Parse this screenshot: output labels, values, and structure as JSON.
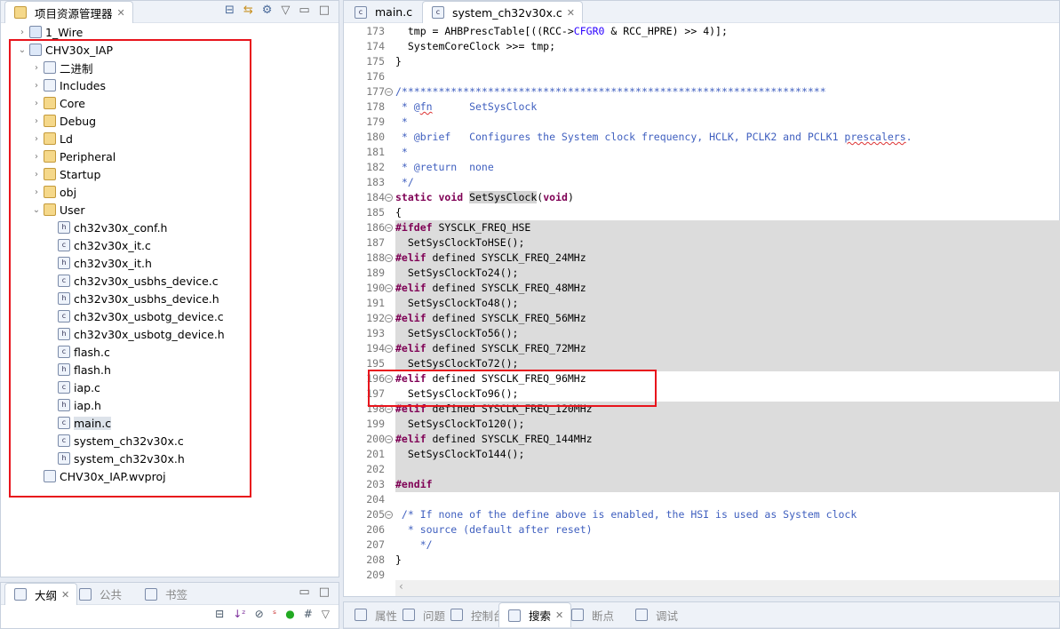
{
  "explorer": {
    "title": "项目资源管理器",
    "tree": [
      {
        "label": "1_Wire",
        "level": 0,
        "expander": "closed",
        "icon": "project-icon"
      },
      {
        "label": "CHV30x_IAP",
        "level": 0,
        "expander": "open",
        "icon": "project-icon"
      },
      {
        "label": "二进制",
        "level": 1,
        "expander": "closed",
        "icon": "binaries-icon"
      },
      {
        "label": "Includes",
        "level": 1,
        "expander": "closed",
        "icon": "includes-icon"
      },
      {
        "label": "Core",
        "level": 1,
        "expander": "closed",
        "icon": "source-folder-icon"
      },
      {
        "label": "Debug",
        "level": 1,
        "expander": "closed",
        "icon": "source-folder-icon"
      },
      {
        "label": "Ld",
        "level": 1,
        "expander": "closed",
        "icon": "source-folder-icon"
      },
      {
        "label": "Peripheral",
        "level": 1,
        "expander": "closed",
        "icon": "source-folder-icon"
      },
      {
        "label": "Startup",
        "level": 1,
        "expander": "closed",
        "icon": "source-folder-icon"
      },
      {
        "label": "obj",
        "level": 1,
        "expander": "closed",
        "icon": "folder-icon"
      },
      {
        "label": "User",
        "level": 1,
        "expander": "open",
        "icon": "folder-icon"
      },
      {
        "label": "ch32v30x_conf.h",
        "level": 2,
        "icon": "h-file-icon"
      },
      {
        "label": "ch32v30x_it.c",
        "level": 2,
        "icon": "c-file-icon"
      },
      {
        "label": "ch32v30x_it.h",
        "level": 2,
        "icon": "h-file-icon"
      },
      {
        "label": "ch32v30x_usbhs_device.c",
        "level": 2,
        "icon": "c-file-icon"
      },
      {
        "label": "ch32v30x_usbhs_device.h",
        "level": 2,
        "icon": "h-file-icon"
      },
      {
        "label": "ch32v30x_usbotg_device.c",
        "level": 2,
        "icon": "c-file-icon"
      },
      {
        "label": "ch32v30x_usbotg_device.h",
        "level": 2,
        "icon": "h-file-icon"
      },
      {
        "label": "flash.c",
        "level": 2,
        "icon": "c-file-icon"
      },
      {
        "label": "flash.h",
        "level": 2,
        "icon": "h-file-icon"
      },
      {
        "label": "iap.c",
        "level": 2,
        "icon": "c-file-icon"
      },
      {
        "label": "iap.h",
        "level": 2,
        "icon": "h-file-icon"
      },
      {
        "label": "main.c",
        "level": 2,
        "icon": "c-file-icon",
        "selected": true
      },
      {
        "label": "system_ch32v30x.c",
        "level": 2,
        "icon": "c-file-icon"
      },
      {
        "label": "system_ch32v30x.h",
        "level": 2,
        "icon": "h-file-icon"
      },
      {
        "label": "CHV30x_IAP.wvproj",
        "level": 1,
        "icon": "wvproj-file-icon"
      }
    ]
  },
  "editor": {
    "tabs": [
      {
        "label": "main.c"
      },
      {
        "label": "system_ch32v30x.c",
        "active": true
      }
    ],
    "lines": [
      {
        "n": "173",
        "s": [
          [
            "",
            "  tmp = AHBPrescTable[((RCC->"
          ],
          [
            "f",
            "CFGR0"
          ],
          [
            "",
            " & RCC_HPRE) >> 4)];"
          ]
        ]
      },
      {
        "n": "174",
        "s": [
          [
            "",
            "  SystemCoreClock >>= tmp;"
          ]
        ]
      },
      {
        "n": "175",
        "s": [
          [
            "",
            "}"
          ]
        ]
      },
      {
        "n": "176",
        "s": []
      },
      {
        "n": "177",
        "fold": true,
        "s": [
          [
            "c",
            "/*********************************************************************"
          ]
        ]
      },
      {
        "n": "178",
        "s": [
          [
            "c",
            " * @"
          ],
          [
            "c sq",
            "fn"
          ],
          [
            "c",
            "      SetSysClock"
          ]
        ]
      },
      {
        "n": "179",
        "s": [
          [
            "c",
            " *"
          ]
        ]
      },
      {
        "n": "180",
        "s": [
          [
            "c",
            " * @brief   Configures the System clock frequency, HCLK, PCLK2 and PCLK1 "
          ],
          [
            "c sq",
            "prescalers"
          ],
          [
            "c",
            "."
          ]
        ]
      },
      {
        "n": "181",
        "s": [
          [
            "c",
            " *"
          ]
        ]
      },
      {
        "n": "182",
        "s": [
          [
            "c",
            " * @return  none"
          ]
        ]
      },
      {
        "n": "183",
        "s": [
          [
            "c",
            " */"
          ]
        ]
      },
      {
        "n": "184",
        "fold": true,
        "s": [
          [
            "k",
            "static"
          ],
          [
            "",
            " "
          ],
          [
            "k",
            "void"
          ],
          [
            "",
            " "
          ],
          [
            "hl",
            "SetSysClock"
          ],
          [
            "",
            "("
          ],
          [
            "k",
            "void"
          ],
          [
            "",
            ")"
          ]
        ]
      },
      {
        "n": "185",
        "s": [
          [
            "",
            "{"
          ]
        ]
      },
      {
        "n": "186",
        "fold": true,
        "shade": true,
        "s": [
          [
            "k",
            "#ifdef"
          ],
          [
            "",
            " SYSCLK_FREQ_HSE"
          ]
        ]
      },
      {
        "n": "187",
        "shade": true,
        "s": [
          [
            "",
            "  SetSysClockToHSE();"
          ]
        ]
      },
      {
        "n": "188",
        "fold": true,
        "shade": true,
        "s": [
          [
            "k",
            "#elif"
          ],
          [
            "",
            " defined SYSCLK_FREQ_24MHz"
          ]
        ]
      },
      {
        "n": "189",
        "shade": true,
        "s": [
          [
            "",
            "  SetSysClockTo24();"
          ]
        ]
      },
      {
        "n": "190",
        "fold": true,
        "shade": true,
        "s": [
          [
            "k",
            "#elif"
          ],
          [
            "",
            " defined SYSCLK_FREQ_48MHz"
          ]
        ]
      },
      {
        "n": "191",
        "shade": true,
        "s": [
          [
            "",
            "  SetSysClockTo48();"
          ]
        ]
      },
      {
        "n": "192",
        "fold": true,
        "shade": true,
        "s": [
          [
            "k",
            "#elif"
          ],
          [
            "",
            " defined SYSCLK_FREQ_56MHz"
          ]
        ]
      },
      {
        "n": "193",
        "shade": true,
        "s": [
          [
            "",
            "  SetSysClockTo56();"
          ]
        ]
      },
      {
        "n": "194",
        "fold": true,
        "shade": true,
        "s": [
          [
            "k",
            "#elif"
          ],
          [
            "",
            " defined SYSCLK_FREQ_72MHz"
          ]
        ]
      },
      {
        "n": "195",
        "shade": true,
        "s": [
          [
            "",
            "  SetSysClockTo72();"
          ]
        ]
      },
      {
        "n": "196",
        "fold": true,
        "s": [
          [
            "k",
            "#elif"
          ],
          [
            "",
            " defined SYSCLK_FREQ_96MHz"
          ]
        ]
      },
      {
        "n": "197",
        "s": [
          [
            "",
            "  SetSysClockTo96();"
          ]
        ]
      },
      {
        "n": "198",
        "fold": true,
        "shade": true,
        "s": [
          [
            "k",
            "#elif"
          ],
          [
            "",
            " defined SYSCLK_FREQ_120MHz"
          ]
        ]
      },
      {
        "n": "199",
        "shade": true,
        "s": [
          [
            "",
            "  SetSysClockTo120();"
          ]
        ]
      },
      {
        "n": "200",
        "fold": true,
        "shade": true,
        "s": [
          [
            "k",
            "#elif"
          ],
          [
            "",
            " defined SYSCLK_FREQ_144MHz"
          ]
        ]
      },
      {
        "n": "201",
        "shade": true,
        "s": [
          [
            "",
            "  SetSysClockTo144();"
          ]
        ]
      },
      {
        "n": "202",
        "shade": true,
        "s": []
      },
      {
        "n": "203",
        "shade": true,
        "s": [
          [
            "k",
            "#endif"
          ]
        ]
      },
      {
        "n": "204",
        "s": []
      },
      {
        "n": "205",
        "fold": true,
        "s": [
          [
            "c",
            " /* If none of the define above is enabled, the HSI is used as System clock"
          ]
        ]
      },
      {
        "n": "206",
        "s": [
          [
            "c",
            "  * source (default after reset)"
          ]
        ]
      },
      {
        "n": "207",
        "s": [
          [
            "c",
            "    */"
          ]
        ]
      },
      {
        "n": "208",
        "s": [
          [
            "",
            "}"
          ]
        ]
      },
      {
        "n": "209",
        "s": []
      }
    ]
  },
  "outline": {
    "tabs": [
      "大纲",
      "公共",
      "书签"
    ]
  },
  "bottom": {
    "tabs": [
      "属性",
      "问题",
      "控制台",
      "搜索",
      "断点",
      "调试"
    ],
    "active": "搜索"
  },
  "colors": {
    "highlight_box": "#e8141c",
    "keyword": "#7f0055",
    "comment": "#3f5fbf",
    "inactive_code": "#dcdcdc"
  }
}
